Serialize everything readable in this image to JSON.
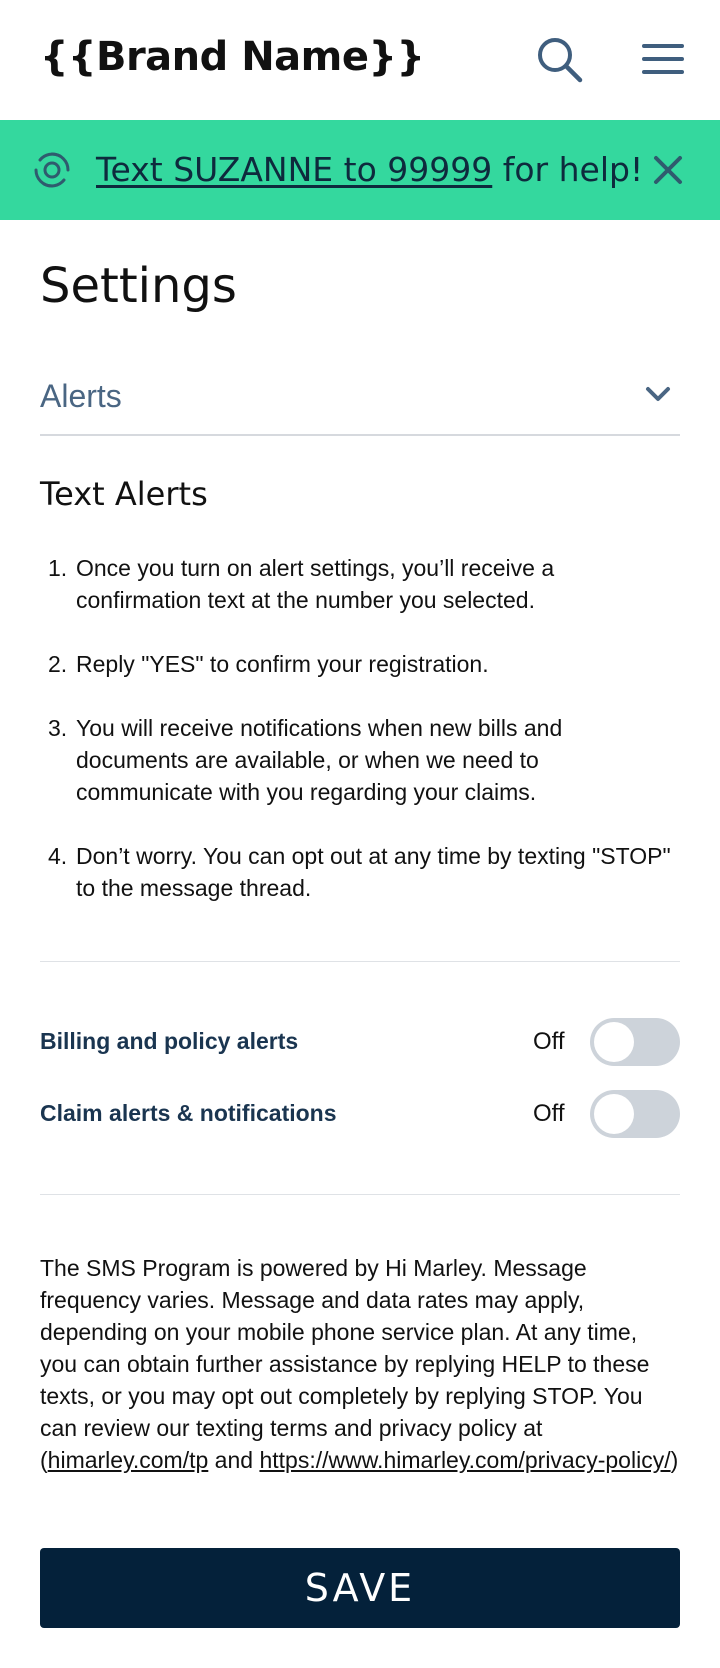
{
  "header": {
    "brand": "{{Brand Name}}",
    "search_icon": "search-icon",
    "menu_icon": "hamburger-menu-icon"
  },
  "banner": {
    "icon": "support-swirl-icon",
    "link_text": "Text SUZANNE to 99999",
    "suffix_text": " for help!",
    "close_icon": "close-icon",
    "background_color": "#34d89e"
  },
  "page": {
    "title": "Settings"
  },
  "accordion": {
    "label": "Alerts",
    "icon": "chevron-down-icon"
  },
  "text_alerts": {
    "title": "Text Alerts",
    "steps": [
      {
        "num": "1.",
        "text": "Once you turn on alert settings, you’ll receive a confirmation text at the number you selected."
      },
      {
        "num": "2.",
        "text": "Reply \"YES\" to confirm your registration."
      },
      {
        "num": "3.",
        "text": "You will receive notifications when new bills and documents are available, or when we need to communicate with you regarding your claims."
      },
      {
        "num": "4.",
        "text": "Don’t worry. You can opt out at any time by texting \"STOP\" to the message thread."
      }
    ]
  },
  "toggles": [
    {
      "label": "Billing and policy alerts",
      "state": "Off"
    },
    {
      "label": "Claim alerts & notifications",
      "state": "Off"
    }
  ],
  "disclaimer": {
    "text": "The SMS Program is powered by Hi Marley. Message frequency varies. Message and data rates may apply, depending on your mobile phone service plan. At any time, you can obtain further assistance by replying HELP to these texts, or you may opt out completely by replying STOP. You can review our texting terms and privacy policy at (",
    "link1": "himarley.com/tp",
    "middle": " and ",
    "link2": "https://www.himarley.com/privacy-policy/",
    "end": ")"
  },
  "save_button": {
    "label": "SAVE",
    "color": "#04213a"
  }
}
